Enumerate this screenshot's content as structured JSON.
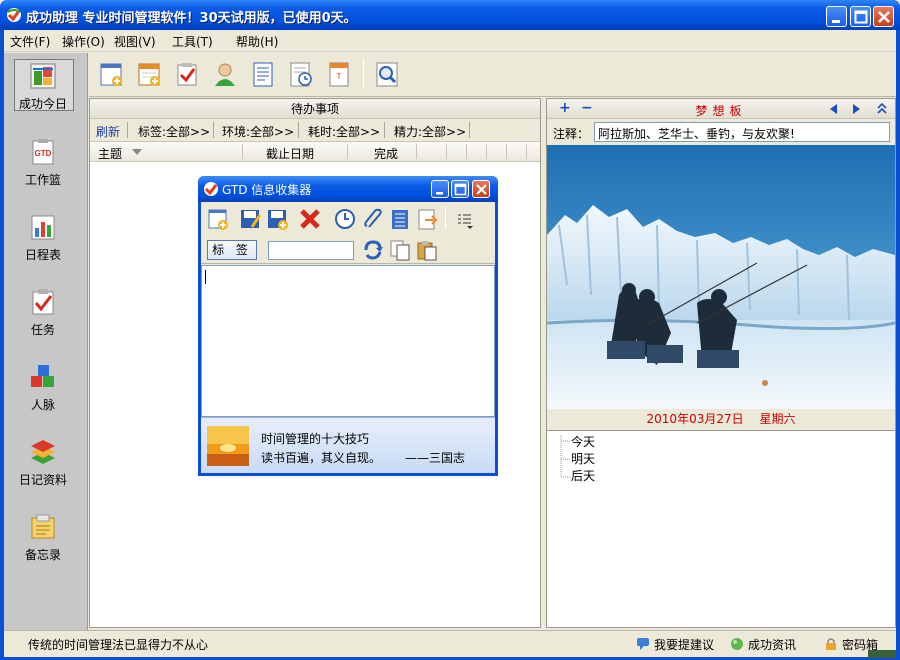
{
  "window": {
    "title": "成功助理  专业时间管理软件！30天试用版，已使用0天。"
  },
  "menu": [
    {
      "label": "文件(F)"
    },
    {
      "label": "操作(O)"
    },
    {
      "label": "视图(V)"
    },
    {
      "label": "工具(T)"
    },
    {
      "label": "帮助(H)"
    }
  ],
  "nav": [
    {
      "label": "成功今日",
      "icon": "today-icon",
      "active": true
    },
    {
      "label": "工作篮",
      "icon": "gtd-basket-icon"
    },
    {
      "label": "日程表",
      "icon": "schedule-chart-icon"
    },
    {
      "label": "任务",
      "icon": "task-check-icon"
    },
    {
      "label": "人脉",
      "icon": "contacts-cubes-icon"
    },
    {
      "label": "日记资料",
      "icon": "diary-books-icon"
    },
    {
      "label": "备忘录",
      "icon": "memo-icon"
    }
  ],
  "center": {
    "header": "待办事项",
    "filters": [
      "刷新",
      "标签:全部>>",
      "环境:全部>>",
      "耗时:全部>>",
      "精力:全部>>"
    ],
    "columns": [
      "主题",
      "截止日期",
      "完成"
    ]
  },
  "dialog": {
    "title": "GTD 信息收集器",
    "tag_label": "标 签",
    "tip_title": "时间管理的十大技巧",
    "tip_quote": "读书百遍，其义自现。",
    "tip_source": "——三国志"
  },
  "right": {
    "plus": "+",
    "minus": "−",
    "title": "梦想板",
    "note_label": "注释：",
    "note_value": "阿拉斯加、芝华士、垂钓，与友欢聚!",
    "date": "2010年03月27日",
    "weekday": "星期六",
    "tree": [
      "今天",
      "明天",
      "后天"
    ]
  },
  "status": {
    "text": "传统的时间管理法已显得力不从心",
    "links": [
      {
        "label": "我要提建议",
        "icon": "chat-bubble-icon"
      },
      {
        "label": "成功资讯",
        "icon": "green-circle-icon"
      },
      {
        "label": "密码箱",
        "icon": "lock-icon"
      }
    ]
  },
  "colors": {
    "titlebar": "#0a5ae6",
    "accent_red": "#cc0000",
    "nav_bg": "#c7c7c7"
  }
}
